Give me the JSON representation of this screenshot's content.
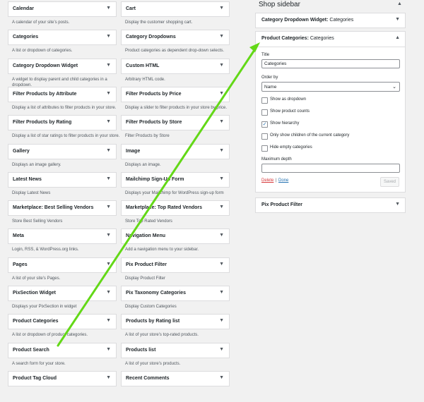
{
  "available_widgets": [
    {
      "title": "Calendar",
      "desc": "A calendar of your site’s posts."
    },
    {
      "title": "Cart",
      "desc": "Display the customer shopping cart."
    },
    {
      "title": "Categories",
      "desc": "A list or dropdown of categories."
    },
    {
      "title": "Category Dropdowns",
      "desc": "Product categories as dependent drop-down selects."
    },
    {
      "title": "Category Dropdown Widget",
      "desc": "A widget to display parent and child categories in a dropdown."
    },
    {
      "title": "Custom HTML",
      "desc": "Arbitrary HTML code."
    },
    {
      "title": "Filter Products by Attribute",
      "desc": "Display a list of attributes to filter products in your store."
    },
    {
      "title": "Filter Products by Price",
      "desc": "Display a slider to filter products in your store by price."
    },
    {
      "title": "Filter Products by Rating",
      "desc": "Display a list of star ratings to filter products in your store."
    },
    {
      "title": "Filter Products by Store",
      "desc": "Filter Products by Store"
    },
    {
      "title": "Gallery",
      "desc": "Displays an image gallery."
    },
    {
      "title": "Image",
      "desc": "Displays an image."
    },
    {
      "title": "Latest News",
      "desc": "Display Latest News"
    },
    {
      "title": "Mailchimp Sign-Up Form",
      "desc": "Displays your Mailchimp for WordPress sign-up form"
    },
    {
      "title": "Marketplace: Best Selling Vendors",
      "desc": "Store Best Selling Vendors"
    },
    {
      "title": "Marketplace: Top Rated Vendors",
      "desc": "Store Top Rated Vendors"
    },
    {
      "title": "Meta",
      "desc": "Login, RSS, & WordPress.org links."
    },
    {
      "title": "Navigation Menu",
      "desc": "Add a navigation menu to your sidebar."
    },
    {
      "title": "Pages",
      "desc": "A list of your site’s Pages."
    },
    {
      "title": "Pix Product Filter",
      "desc": "Display Product Filter"
    },
    {
      "title": "PixSection Widget",
      "desc": "Displays your PixSection in widget"
    },
    {
      "title": "Pix Taxonomy Categories",
      "desc": "Display Custom Categories"
    },
    {
      "title": "Product Categories",
      "desc": "A list or dropdown of product categories."
    },
    {
      "title": "Products by Rating list",
      "desc": "A list of your store’s top-rated products."
    },
    {
      "title": "Product Search",
      "desc": "A search form for your store."
    },
    {
      "title": "Products list",
      "desc": "A list of your store’s products."
    },
    {
      "title": "Product Tag Cloud",
      "desc": ""
    },
    {
      "title": "Recent Comments",
      "desc": ""
    }
  ],
  "sidebar": {
    "title": "Shop sidebar",
    "widget1": {
      "title": "Category Dropdown Widget:",
      "subtitle": "Categories"
    },
    "panel": {
      "title": "Product Categories:",
      "subtitle": "Categories",
      "title_label": "Title",
      "title_value": "Categories",
      "orderby_label": "Order by",
      "orderby_value": "Name",
      "checkboxes": [
        {
          "label": "Show as dropdown",
          "checked": false
        },
        {
          "label": "Show product counts",
          "checked": false
        },
        {
          "label": "Show hierarchy",
          "checked": true
        },
        {
          "label": "Only show children of the current category",
          "checked": false
        },
        {
          "label": "Hide empty categories",
          "checked": false
        }
      ],
      "max_depth_label": "Maximum depth",
      "max_depth_value": "",
      "delete_label": "Delete",
      "separator": "|",
      "done_label": "Done",
      "saved_label": "Saved"
    },
    "widget3": {
      "title": "Pix Product Filter"
    }
  },
  "icons": {
    "collapsed": "caret-down-icon",
    "expanded": "caret-up-icon"
  },
  "colors": {
    "arrow": "#63d817",
    "delete": "#d63638",
    "link": "#2271b1"
  }
}
